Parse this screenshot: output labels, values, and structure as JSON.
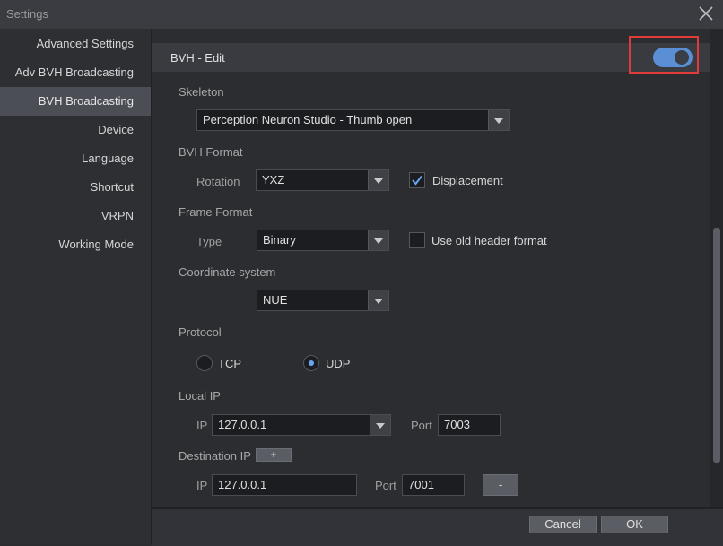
{
  "window": {
    "title": "Settings",
    "close_icon": "close-icon"
  },
  "sidebar": {
    "items": [
      {
        "label": "Advanced Settings"
      },
      {
        "label": "Adv BVH Broadcasting"
      },
      {
        "label": "BVH Broadcasting",
        "active": true
      },
      {
        "label": "Device"
      },
      {
        "label": "Language"
      },
      {
        "label": "Shortcut"
      },
      {
        "label": "VRPN"
      },
      {
        "label": "Working Mode"
      }
    ]
  },
  "section": {
    "title": "BVH - Edit",
    "toggle_on": true,
    "accent": "#5a8fd6",
    "highlight_color": "#e03a3a"
  },
  "skeleton": {
    "label": "Skeleton",
    "value": "Perception Neuron Studio - Thumb open"
  },
  "bvh_format": {
    "label": "BVH Format",
    "rotation_label": "Rotation",
    "rotation_value": "YXZ",
    "displacement_label": "Displacement",
    "displacement_checked": true
  },
  "frame_format": {
    "label": "Frame Format",
    "type_label": "Type",
    "type_value": "Binary",
    "old_header_label": "Use old header format",
    "old_header_checked": false
  },
  "coordinate": {
    "label": "Coordinate system",
    "value": "NUE"
  },
  "protocol": {
    "label": "Protocol",
    "tcp_label": "TCP",
    "udp_label": "UDP",
    "selected": "UDP"
  },
  "local_ip": {
    "label": "Local IP",
    "ip_label": "IP",
    "ip_value": "127.0.0.1",
    "port_label": "Port",
    "port_value": "7003"
  },
  "destination_ip": {
    "label": "Destination IP",
    "add_label": "+",
    "ip_label": "IP",
    "ip_value": "127.0.0.1",
    "port_label": "Port",
    "port_value": "7001",
    "remove_label": "-"
  },
  "footer": {
    "cancel_label": "Cancel",
    "ok_label": "OK"
  }
}
